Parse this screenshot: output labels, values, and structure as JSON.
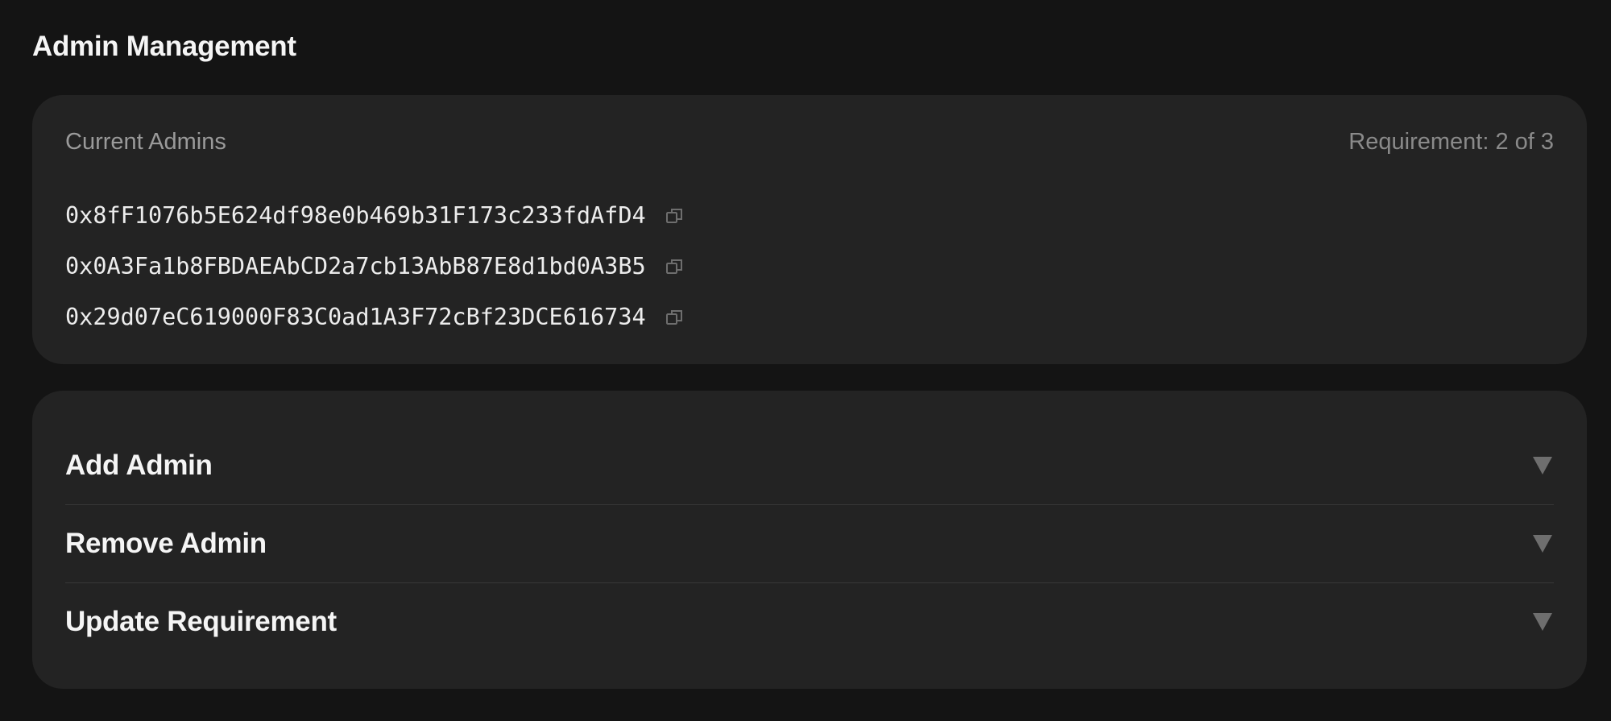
{
  "page": {
    "title": "Admin Management"
  },
  "admins_card": {
    "section_label": "Current Admins",
    "requirement_label": "Requirement: 2 of 3",
    "admins": [
      {
        "address": "0x8fF1076b5E624df98e0b469b31F173c233fdAfD4",
        "icon": "copy-icon"
      },
      {
        "address": "0x0A3Fa1b8FBDAEAbCD2a7cb13AbB87E8d1bd0A3B5",
        "icon": "copy-icon"
      },
      {
        "address": "0x29d07eC619000F83C0ad1A3F72cBf23DCE616734",
        "icon": "copy-icon"
      }
    ]
  },
  "actions": {
    "items": [
      {
        "label": "Add Admin",
        "icon": "chevron-down-icon"
      },
      {
        "label": "Remove Admin",
        "icon": "chevron-down-icon"
      },
      {
        "label": "Update Requirement",
        "icon": "chevron-down-icon"
      }
    ]
  },
  "colors": {
    "background": "#141414",
    "card": "#232323",
    "text_primary": "#f5f5f5",
    "text_muted": "#9a9a9a",
    "divider": "#373737",
    "icon": "#6e6e6e"
  }
}
